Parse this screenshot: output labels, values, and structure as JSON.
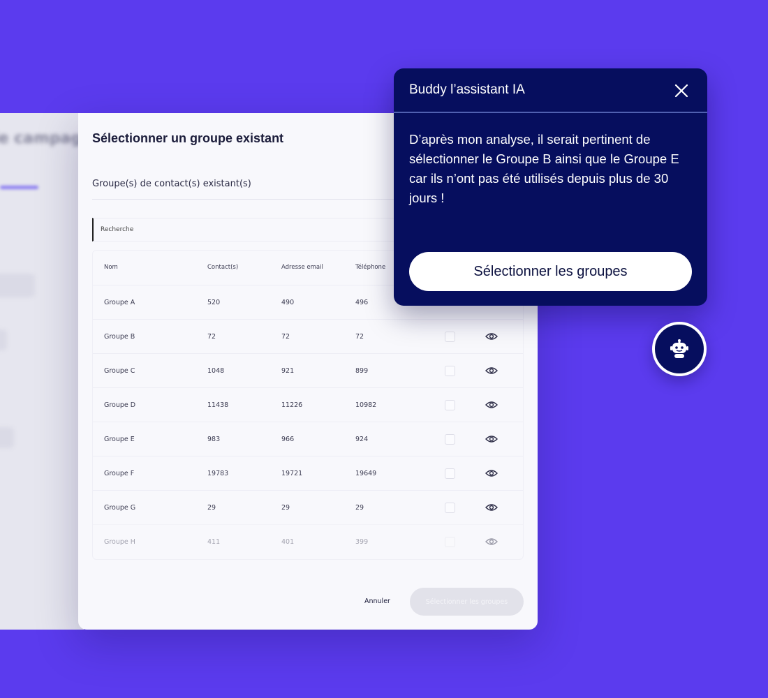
{
  "modal": {
    "title": "Sélectionner un groupe existant",
    "section_label": "Groupe(s) de contact(s) existant(s)",
    "search_placeholder": "Recherche",
    "table": {
      "headers": [
        "Nom",
        "Contact(s)",
        "Adresse email",
        "Téléphone"
      ],
      "rows": [
        {
          "name": "Groupe A",
          "contacts": "520",
          "email": "490",
          "phone": "496"
        },
        {
          "name": "Groupe B",
          "contacts": "72",
          "email": "72",
          "phone": "72"
        },
        {
          "name": "Groupe C",
          "contacts": "1048",
          "email": "921",
          "phone": "899"
        },
        {
          "name": "Groupe D",
          "contacts": "11438",
          "email": "11226",
          "phone": "10982"
        },
        {
          "name": "Groupe E",
          "contacts": "983",
          "email": "966",
          "phone": "924"
        },
        {
          "name": "Groupe F",
          "contacts": "19783",
          "email": "19721",
          "phone": "19649"
        },
        {
          "name": "Groupe G",
          "contacts": "29",
          "email": "29",
          "phone": "29"
        },
        {
          "name": "Groupe H",
          "contacts": "411",
          "email": "401",
          "phone": "399"
        }
      ]
    },
    "cancel_label": "Annuler",
    "submit_label": "Sélectionner les groupes"
  },
  "assistant": {
    "title": "Buddy l’assistant IA",
    "message": "D’après mon analyse, il serait pertinent de sélectionner le Groupe B ainsi que le Groupe E car ils n’ont pas été utilisés depuis plus de 30 jours !",
    "cta_label": "Sélectionner les groupes"
  },
  "colors": {
    "background": "#5b3bee",
    "assistant_bg": "#060e5e",
    "modal_bg": "#f8f8fc"
  },
  "icons": {
    "close": "close-icon",
    "view": "eye-icon",
    "bot": "robot-icon"
  }
}
